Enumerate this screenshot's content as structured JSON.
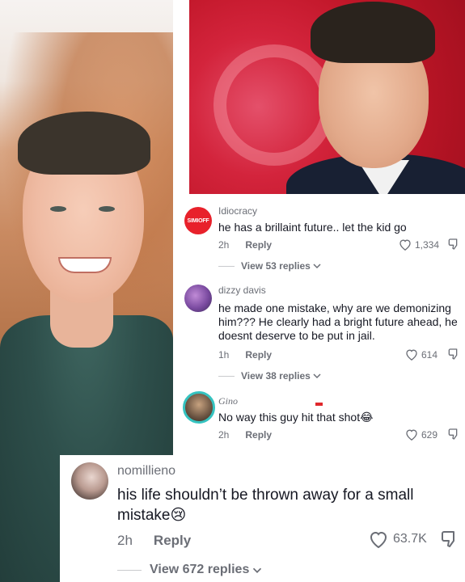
{
  "comments": [
    {
      "username": "Idiocracy",
      "avatar_label": "SIMIOFF",
      "text": "he has a brillaint future.. let the kid go",
      "time": "2h",
      "reply_label": "Reply",
      "likes": "1,334",
      "view_replies": "View 53 replies"
    },
    {
      "username": "dizzy davis",
      "text": "he made one mistake, why are we demonizing him??? He clearly had a bright future ahead, he doesnt deserve to be put in jail.",
      "time": "1h",
      "reply_label": "Reply",
      "likes": "614",
      "view_replies": "View 38 replies"
    },
    {
      "username": "Gino",
      "text": "No way this guy hit that shot",
      "emoji": "😂",
      "time": "2h",
      "reply_label": "Reply",
      "likes": "629"
    },
    {
      "username": "nomillieno",
      "text": "his life shouldn’t be thrown away for a small mistake",
      "emoji": "😢",
      "time": "2h",
      "reply_label": "Reply",
      "likes": "63.7K",
      "view_replies": "View 672 replies"
    }
  ],
  "colors": {
    "text": "#161823",
    "muted": "#6b6e76",
    "avatar_red": "#e8212b"
  },
  "icons": [
    "heart-outline-icon",
    "dislike-icon",
    "chevron-down-icon"
  ]
}
